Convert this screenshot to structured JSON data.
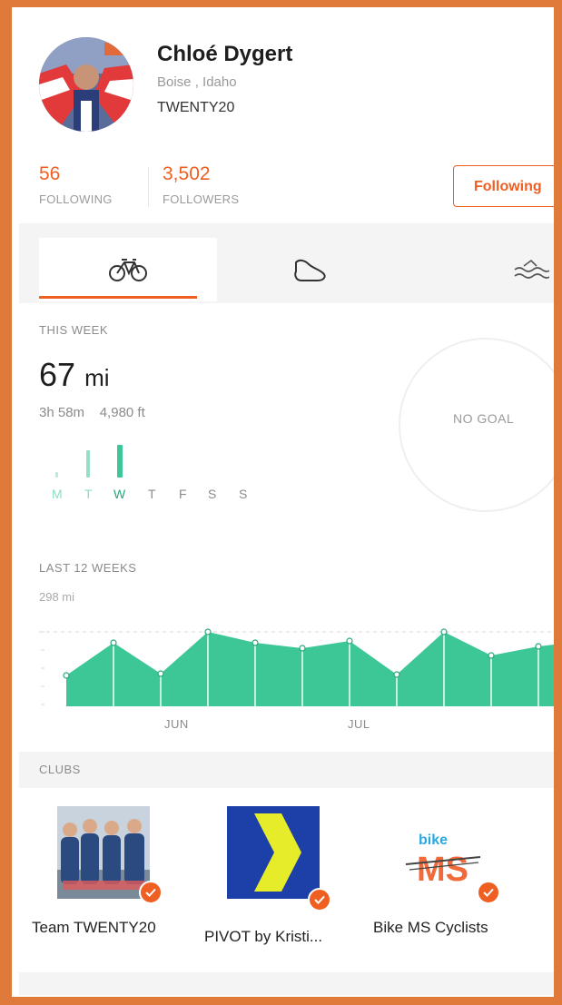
{
  "profile": {
    "name": "Chloé Dygert",
    "location": "Boise , Idaho",
    "team": "TWENTY20"
  },
  "stats": {
    "following_count": "56",
    "following_label": "FOLLOWING",
    "followers_count": "3,502",
    "followers_label": "FOLLOWERS"
  },
  "follow_button_label": "Following",
  "tabs": [
    {
      "icon": "bike-icon",
      "active": true
    },
    {
      "icon": "shoe-icon",
      "active": false
    },
    {
      "icon": "swim-icon",
      "active": false
    }
  ],
  "this_week": {
    "label": "THIS WEEK",
    "distance": "67",
    "unit": "mi",
    "time": "3h 58m",
    "elevation": "4,980 ft",
    "days": [
      "M",
      "T",
      "W",
      "T",
      "F",
      "S",
      "S"
    ],
    "goal_text": "NO GOAL"
  },
  "last_12_weeks": {
    "label": "LAST 12 WEEKS",
    "max_label": "298 mi",
    "months": [
      "JUN",
      "JUL"
    ]
  },
  "clubs": {
    "label": "CLUBS",
    "items": [
      {
        "name": "Team TWENTY20"
      },
      {
        "name": "PIVOT by Kristi..."
      },
      {
        "name": "Bike MS Cyclists",
        "logo_text_top": "bike",
        "logo_text_main": "MS"
      }
    ]
  },
  "colors": {
    "accent": "#f05f22",
    "chart_green": "#3ec796",
    "frame": "#e07a3a"
  }
}
